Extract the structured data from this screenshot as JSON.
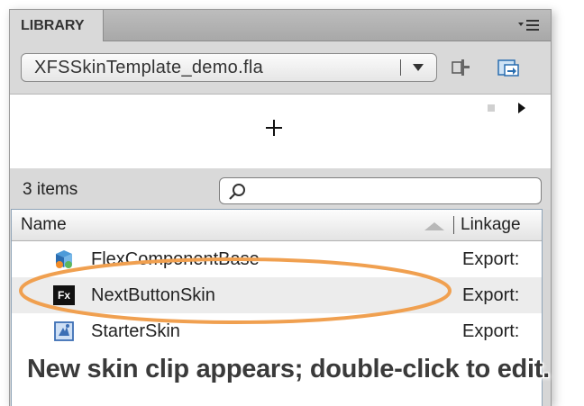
{
  "panel": {
    "tab_title": "LIBRARY",
    "menu_icon": "panel-menu-icon"
  },
  "file": {
    "selected": "XFSSkinTemplate_demo.fla",
    "pin_icon": "pin-library-icon",
    "new_library_icon": "new-library-panel-icon"
  },
  "preview": {
    "crosshair_icon": "crosshair-icon",
    "stop_icon": "stop-icon",
    "play_icon": "play-icon"
  },
  "search": {
    "count_label": "3 items",
    "placeholder": ""
  },
  "list": {
    "columns": [
      "Name",
      "Linkage"
    ],
    "rows": [
      {
        "name": "FlexComponentBase",
        "linkage": "Export:",
        "icon": "component-icon"
      },
      {
        "name": "NextButtonSkin",
        "linkage": "Export:",
        "icon": "fx-icon",
        "icon_text": "Fx"
      },
      {
        "name": "StarterSkin",
        "linkage": "Export:",
        "icon": "movieclip-icon"
      }
    ]
  },
  "annotation": {
    "caption": "New skin clip appears; double-click to edit.",
    "highlight_color": "#f0a050"
  },
  "colors": {
    "panel_bg": "#d9d9d9",
    "selected_row": "#ececec",
    "accent": "#f0a050"
  }
}
